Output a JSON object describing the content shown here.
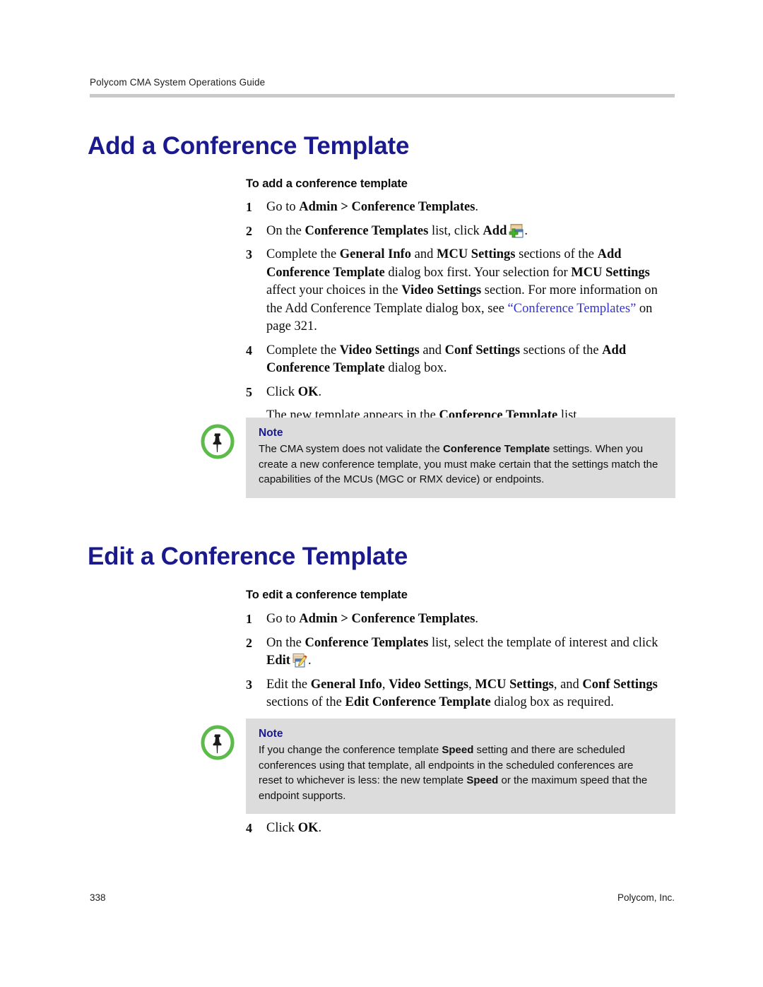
{
  "document": {
    "running_header": "Polycom CMA System Operations Guide",
    "footer_page_number": "338",
    "footer_company": "Polycom, Inc.",
    "colors": {
      "heading_blue": "#1a1a8e",
      "link_blue": "#3333cc",
      "note_background": "#dcdcdc",
      "header_rule": "#c9c9c9",
      "note_icon_green": "#5cbb4a"
    }
  },
  "sections": {
    "add": {
      "heading": "Add a Conference Template",
      "procedure_title": "To add a conference template",
      "steps": [
        {
          "num": "1",
          "parts": [
            {
              "t": "Go to ",
              "s": "plain"
            },
            {
              "t": "Admin > Conference Templates",
              "s": "bold"
            },
            {
              "t": ".",
              "s": "plain"
            }
          ]
        },
        {
          "num": "2",
          "parts": [
            {
              "t": "On the ",
              "s": "plain"
            },
            {
              "t": "Conference Templates",
              "s": "bold"
            },
            {
              "t": " list, click ",
              "s": "plain"
            },
            {
              "t": "Add",
              "s": "bold"
            },
            {
              "t": "",
              "s": "icon-add"
            },
            {
              "t": ".",
              "s": "plain"
            }
          ]
        },
        {
          "num": "3",
          "parts": [
            {
              "t": "Complete the ",
              "s": "plain"
            },
            {
              "t": "General Info",
              "s": "bold"
            },
            {
              "t": " and ",
              "s": "plain"
            },
            {
              "t": "MCU Settings",
              "s": "bold"
            },
            {
              "t": " sections of the ",
              "s": "plain"
            },
            {
              "t": "Add Conference Template",
              "s": "bold"
            },
            {
              "t": " dialog box first. Your selection for ",
              "s": "plain"
            },
            {
              "t": "MCU Settings",
              "s": "bold"
            },
            {
              "t": " affect your choices in the ",
              "s": "plain"
            },
            {
              "t": "Video Settings",
              "s": "bold"
            },
            {
              "t": " section. For more information on the Add Conference Template dialog box, see ",
              "s": "plain"
            },
            {
              "t": "“Conference Templates”",
              "s": "link"
            },
            {
              "t": " on page 321.",
              "s": "plain"
            }
          ]
        },
        {
          "num": "4",
          "parts": [
            {
              "t": "Complete the ",
              "s": "plain"
            },
            {
              "t": "Video Settings",
              "s": "bold"
            },
            {
              "t": " and ",
              "s": "plain"
            },
            {
              "t": "Conf Settings",
              "s": "bold"
            },
            {
              "t": " sections of the ",
              "s": "plain"
            },
            {
              "t": "Add Conference Template",
              "s": "bold"
            },
            {
              "t": " dialog box.",
              "s": "plain"
            }
          ]
        },
        {
          "num": "5",
          "parts": [
            {
              "t": "Click ",
              "s": "plain"
            },
            {
              "t": "OK",
              "s": "bold"
            },
            {
              "t": ".",
              "s": "plain"
            }
          ]
        },
        {
          "num": "",
          "parts": [
            {
              "t": "The new template appears in the ",
              "s": "plain"
            },
            {
              "t": "Conference Template",
              "s": "bold"
            },
            {
              "t": " list.",
              "s": "plain"
            }
          ]
        }
      ],
      "note": {
        "label": "Note",
        "icon": "note-pushpin-icon",
        "parts": [
          {
            "t": "The CMA system does not validate the ",
            "s": "plain"
          },
          {
            "t": "Conference Template",
            "s": "bold"
          },
          {
            "t": " settings. When you create a new conference template, you must make certain that the settings match the capabilities of the MCUs (MGC or RMX device) or endpoints.",
            "s": "plain"
          }
        ]
      }
    },
    "edit": {
      "heading": "Edit a Conference Template",
      "procedure_title": "To edit a conference template",
      "steps": [
        {
          "num": "1",
          "parts": [
            {
              "t": "Go to ",
              "s": "plain"
            },
            {
              "t": "Admin > Conference Templates",
              "s": "bold"
            },
            {
              "t": ".",
              "s": "plain"
            }
          ]
        },
        {
          "num": "2",
          "parts": [
            {
              "t": "On the ",
              "s": "plain"
            },
            {
              "t": "Conference Templates",
              "s": "bold"
            },
            {
              "t": " list, select the template of interest and click ",
              "s": "plain"
            },
            {
              "t": "Edit",
              "s": "bold"
            },
            {
              "t": "",
              "s": "icon-edit"
            },
            {
              "t": ".",
              "s": "plain"
            }
          ]
        },
        {
          "num": "3",
          "parts": [
            {
              "t": "Edit the ",
              "s": "plain"
            },
            {
              "t": "General Info",
              "s": "bold"
            },
            {
              "t": ", ",
              "s": "plain"
            },
            {
              "t": "Video Settings",
              "s": "bold"
            },
            {
              "t": ", ",
              "s": "plain"
            },
            {
              "t": "MCU Settings",
              "s": "bold"
            },
            {
              "t": ", and ",
              "s": "plain"
            },
            {
              "t": "Conf Settings",
              "s": "bold"
            },
            {
              "t": " sections of the ",
              "s": "plain"
            },
            {
              "t": "Edit Conference Template",
              "s": "bold"
            },
            {
              "t": " dialog box as required.",
              "s": "plain"
            }
          ]
        }
      ],
      "note": {
        "label": "Note",
        "icon": "note-pushpin-icon",
        "parts": [
          {
            "t": "If you change the conference template ",
            "s": "plain"
          },
          {
            "t": "Speed",
            "s": "bold"
          },
          {
            "t": " setting and there are scheduled conferences using that template, all endpoints in the scheduled conferences are reset to whichever is less: the new template ",
            "s": "plain"
          },
          {
            "t": "Speed",
            "s": "bold"
          },
          {
            "t": " or the maximum speed that the endpoint supports.",
            "s": "plain"
          }
        ]
      },
      "steps_after_note": [
        {
          "num": "4",
          "parts": [
            {
              "t": "Click ",
              "s": "plain"
            },
            {
              "t": "OK",
              "s": "bold"
            },
            {
              "t": ".",
              "s": "plain"
            }
          ]
        }
      ]
    }
  }
}
